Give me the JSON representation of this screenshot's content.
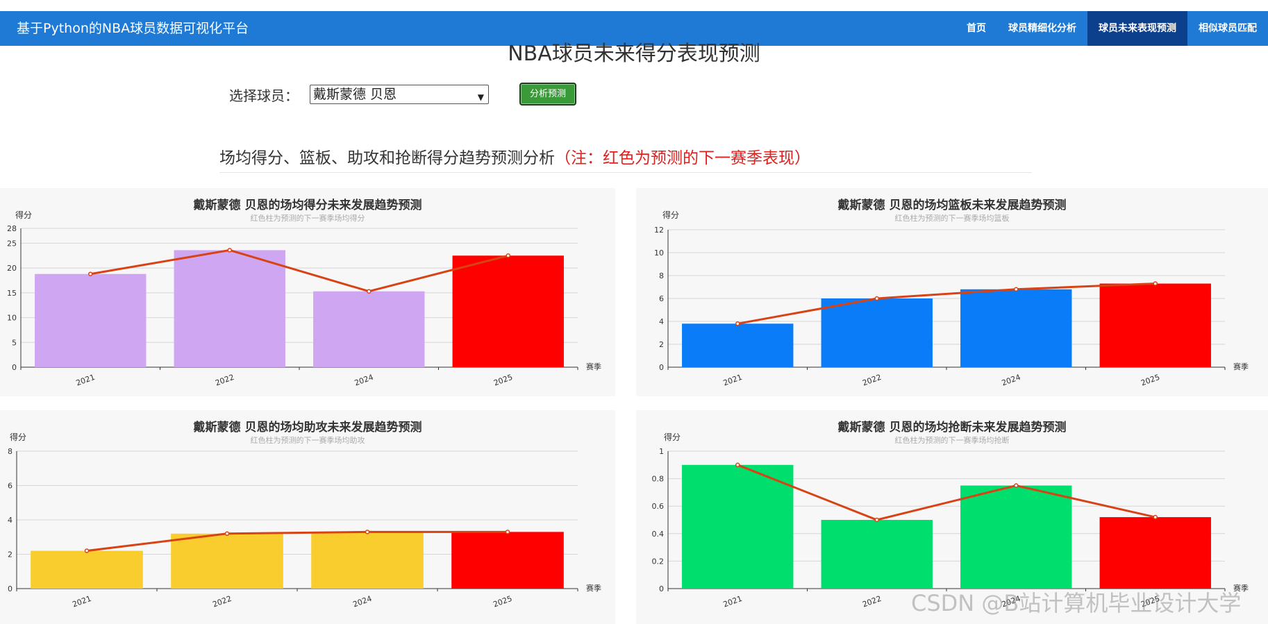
{
  "nav": {
    "brand": "基于Python的NBA球员数据可视化平台",
    "items": [
      {
        "label": "首页",
        "active": false
      },
      {
        "label": "球员精细化分析",
        "active": false
      },
      {
        "label": "球员未来表现预测",
        "active": true
      },
      {
        "label": "相似球员匹配",
        "active": false
      }
    ]
  },
  "page": {
    "title": "NBA球员未来得分表现预测",
    "player_label": "选择球员：",
    "player_value": "戴斯蒙德 贝恩",
    "analyze_button": "分析预测",
    "section_heading": "场均得分、篮板、助攻和抢断得分趋势预测分析",
    "section_note": "（注：红色为预测的下一赛季表现）",
    "watermark": "CSDN @B站计算机毕业设计大学"
  },
  "colors": {
    "navbar": "#1f7ad6",
    "nav_active": "#0c3f8c",
    "predicted_bar": "#ff0000",
    "trend_line": "#d84315"
  },
  "chart_data": [
    {
      "type": "bar",
      "title": "戴斯蒙德 贝恩的场均得分未来发展趋势预测",
      "subtitle": "红色柱为预测的下一赛季场均得分",
      "ylabel": "得分",
      "xlabel": "赛季",
      "categories": [
        "2021",
        "2022",
        "2024",
        "2025"
      ],
      "values": [
        18.8,
        23.6,
        15.3,
        22.5
      ],
      "ylim": [
        0,
        28
      ],
      "yticks": [
        0,
        5,
        10,
        15,
        20,
        25,
        28
      ],
      "bar_color": "#cfa6f2",
      "predicted_color": "#ff0000",
      "line_color": "#d84315",
      "grid": true
    },
    {
      "type": "bar",
      "title": "戴斯蒙德 贝恩的场均篮板未来发展趋势预测",
      "subtitle": "红色柱为预测的下一赛季场均篮板",
      "ylabel": "得分",
      "xlabel": "赛季",
      "categories": [
        "2021",
        "2022",
        "2024",
        "2025"
      ],
      "values": [
        3.8,
        6.0,
        6.8,
        7.3
      ],
      "ylim": [
        0,
        12
      ],
      "yticks": [
        0,
        2,
        4,
        6,
        8,
        10,
        12
      ],
      "bar_color": "#0a7cf7",
      "predicted_color": "#ff0000",
      "line_color": "#d84315",
      "grid": true
    },
    {
      "type": "bar",
      "title": "戴斯蒙德 贝恩的场均助攻未来发展趋势预测",
      "subtitle": "红色柱为预测的下一赛季场均助攻",
      "ylabel": "得分",
      "xlabel": "赛季",
      "categories": [
        "2021",
        "2022",
        "2024",
        "2025"
      ],
      "values": [
        2.2,
        3.2,
        3.3,
        3.3
      ],
      "ylim": [
        0,
        8
      ],
      "yticks": [
        0,
        2,
        4,
        6,
        8
      ],
      "bar_color": "#f9cd2d",
      "predicted_color": "#ff0000",
      "line_color": "#d84315",
      "grid": true
    },
    {
      "type": "bar",
      "title": "戴斯蒙德 贝恩的场均抢断未来发展趋势预测",
      "subtitle": "红色柱为预测的下一赛季场均抢断",
      "ylabel": "得分",
      "xlabel": "赛季",
      "categories": [
        "2021",
        "2022",
        "2024",
        "2025"
      ],
      "values": [
        0.9,
        0.5,
        0.75,
        0.52
      ],
      "ylim": [
        0,
        1
      ],
      "yticks": [
        0,
        0.2,
        0.4,
        0.6,
        0.8,
        1
      ],
      "bar_color": "#00de6e",
      "predicted_color": "#ff0000",
      "line_color": "#d84315",
      "grid": true
    }
  ]
}
